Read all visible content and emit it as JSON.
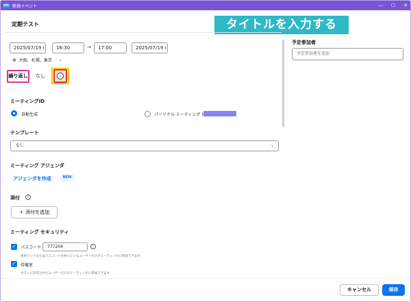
{
  "window": {
    "title": "新規イベント",
    "app_badge": "zm",
    "minimize": "—",
    "maximize": "☐",
    "close": "✕"
  },
  "banner": {
    "text": "タイトルを入力する"
  },
  "page_title": "定期テスト",
  "schedule": {
    "start_date": "2025/07/19 (±",
    "start_time": "16:30",
    "arrow": "→",
    "end_time": "17:00",
    "end_date": "2025/07/19 (±",
    "timezone": "大阪、札幌、東京"
  },
  "recurrence": {
    "label": "繰り返し",
    "value": "なし"
  },
  "meeting_id": {
    "label": "ミーティングID",
    "auto": "自動生成",
    "personal": "パーソナル ミーティング ID"
  },
  "template": {
    "label": "テンプレート",
    "value": "なし"
  },
  "agenda": {
    "label": "ミーティング アジェンダ",
    "link": "アジェンダを作成",
    "badge": "NEW"
  },
  "attachment": {
    "label": "添付",
    "button": "添付を追加"
  },
  "security": {
    "label": "ミーティング セキュリティ",
    "passcode_label": "パスコード",
    "passcode_value": "777204",
    "passcode_hint": "招待リンクまたはパスコードを持っているユーザーだけがミーティングに参加できます",
    "waiting_room_label": "待機室",
    "waiting_room_hint": "ホストに許可されたユーザーだけがミーティングに参加できます"
  },
  "attendees": {
    "label": "予定参加者",
    "placeholder": "予定参加者を追加"
  },
  "footer": {
    "cancel": "キャンセル",
    "save": "保存"
  }
}
